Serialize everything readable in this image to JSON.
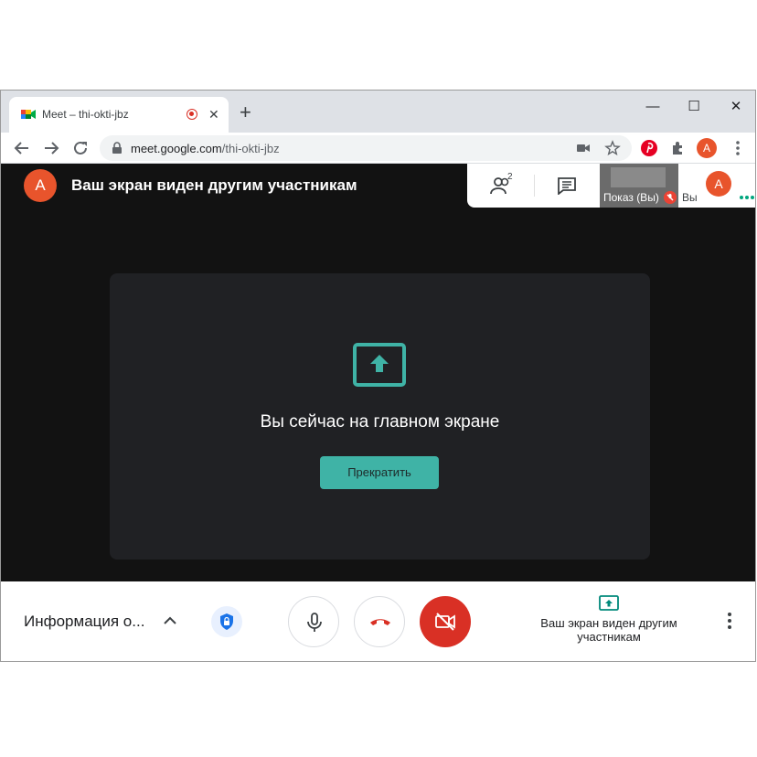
{
  "browser": {
    "tab_title": "Meet – thi-okti-jbz",
    "tab_close": "✕",
    "new_tab": "+",
    "window_controls": {
      "minimize": "—",
      "maximize": "☐",
      "close": "✕"
    },
    "url_host": "meet.google.com",
    "url_path": "/thi-okti-jbz",
    "profile_initial": "A"
  },
  "meet": {
    "user_initial": "A",
    "banner": "Ваш экран виден другим участникам",
    "participants_count": "2",
    "tiles": {
      "presenting_label": "Показ (Вы)",
      "me_label": "Вы",
      "me_initial": "A"
    },
    "center": {
      "title": "Вы сейчас на главном экране",
      "stop_label": "Прекратить"
    },
    "bottom": {
      "meeting_info": "Информация о...",
      "share_status": "Ваш экран виден другим участникам"
    }
  },
  "colors": {
    "accent_teal": "#3fb3a6",
    "hangup_red": "#d93025",
    "avatar_orange": "#e8542c"
  }
}
